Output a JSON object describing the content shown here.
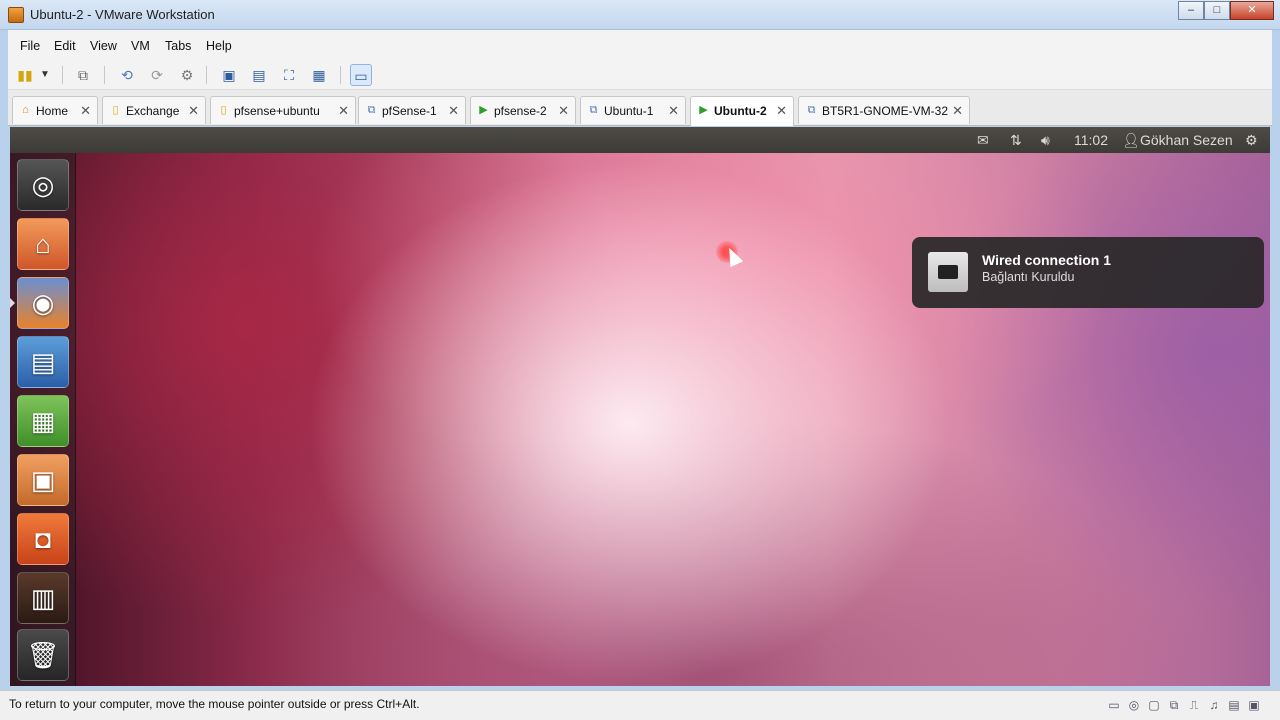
{
  "window": {
    "title": "Ubuntu-2 - VMware Workstation",
    "controls": [
      "minimize",
      "maximize",
      "close"
    ]
  },
  "menu": [
    "File",
    "Edit",
    "View",
    "VM",
    "Tabs",
    "Help"
  ],
  "toolbar": {
    "icons": [
      "power-icon",
      "dropdown-icon",
      "network-icon",
      "snapshot-icon",
      "revert-icon",
      "snapshot-manager-icon",
      "quick-switch-icon",
      "exclusive-icon",
      "fullscreen-icon",
      "console-view-icon",
      "unity-icon"
    ]
  },
  "tabs": [
    {
      "label": "Home",
      "icon": "home-icon",
      "active": false
    },
    {
      "label": "Exchange",
      "icon": "folder-icon",
      "active": false
    },
    {
      "label": "pfsense+ubuntu",
      "icon": "folder-icon",
      "active": false
    },
    {
      "label": "pfSense-1",
      "icon": "vm-icon",
      "active": false
    },
    {
      "label": "pfsense-2",
      "icon": "vm-running-icon",
      "active": false
    },
    {
      "label": "Ubuntu-1",
      "icon": "vm-icon",
      "active": false
    },
    {
      "label": "Ubuntu-2",
      "icon": "vm-running-icon",
      "active": true
    },
    {
      "label": "BT5R1-GNOME-VM-32",
      "icon": "vm-icon",
      "active": false
    }
  ],
  "ubuntu_panel": {
    "time": "11:02",
    "user": "Gökhan Sezen"
  },
  "launcher": [
    {
      "name": "dash",
      "icon": "ubuntu-logo-icon"
    },
    {
      "name": "home-folder",
      "icon": "folder-home-icon"
    },
    {
      "name": "firefox",
      "icon": "firefox-icon"
    },
    {
      "name": "writer",
      "icon": "document-icon"
    },
    {
      "name": "calc",
      "icon": "spreadsheet-icon"
    },
    {
      "name": "impress",
      "icon": "presentation-icon"
    },
    {
      "name": "software-center",
      "icon": "shopping-bag-icon"
    },
    {
      "name": "workspaces",
      "icon": "workspace-icon"
    },
    {
      "name": "trash",
      "icon": "trash-icon"
    }
  ],
  "notification": {
    "title": "Wired connection 1",
    "body": "Bağlantı Kuruldu"
  },
  "statusbar": {
    "text": "To return to your computer, move the mouse pointer outside or press Ctrl+Alt."
  }
}
